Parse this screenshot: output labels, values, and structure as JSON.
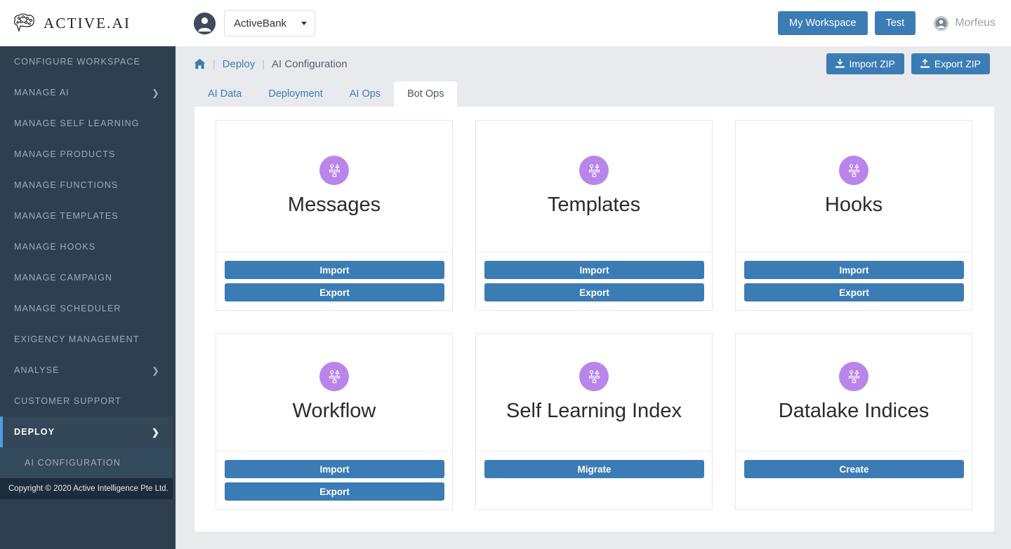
{
  "header": {
    "brand_name": "ACTIVE.AI",
    "brand_logo_icon": "brain-circuit-icon",
    "workspace_avatar_icon": "user-avatar-icon",
    "workspace_value": "ActiveBank",
    "workspace_caret_icon": "caret-down-icon",
    "my_workspace_label": "My Workspace",
    "test_label": "Test",
    "user_avatar_icon": "user-circle-icon",
    "user_name": "Morfeus"
  },
  "sidebar": {
    "items": [
      {
        "label": "CONFIGURE WORKSPACE",
        "has_chevron": false,
        "active": false
      },
      {
        "label": "MANAGE AI",
        "has_chevron": true,
        "active": false
      },
      {
        "label": "MANAGE SELF LEARNING",
        "has_chevron": false,
        "active": false
      },
      {
        "label": "MANAGE PRODUCTS",
        "has_chevron": false,
        "active": false
      },
      {
        "label": "MANAGE FUNCTIONS",
        "has_chevron": false,
        "active": false
      },
      {
        "label": "MANAGE TEMPLATES",
        "has_chevron": false,
        "active": false
      },
      {
        "label": "MANAGE HOOKS",
        "has_chevron": false,
        "active": false
      },
      {
        "label": "MANAGE CAMPAIGN",
        "has_chevron": false,
        "active": false
      },
      {
        "label": "MANAGE SCHEDULER",
        "has_chevron": false,
        "active": false
      },
      {
        "label": "EXIGENCY MANAGEMENT",
        "has_chevron": false,
        "active": false
      },
      {
        "label": "ANALYSE",
        "has_chevron": true,
        "active": false
      },
      {
        "label": "CUSTOMER SUPPORT",
        "has_chevron": false,
        "active": false
      },
      {
        "label": "DEPLOY",
        "has_chevron": true,
        "active": true
      }
    ],
    "sub_item": "AI CONFIGURATION",
    "chevron_icon": "chevron-right-icon",
    "copyright": "Copyright © 2020 Active Intelligence Pte Ltd.",
    "accent_color": "#4a9fe0",
    "background_color": "#2e3f50"
  },
  "topbar": {
    "home_icon": "home-icon",
    "breadcrumb": [
      {
        "label": "Deploy",
        "type": "link"
      },
      {
        "label": "AI Configuration",
        "type": "current"
      }
    ],
    "separator": "|",
    "import_zip_label": "Import ZIP",
    "import_zip_icon": "download-icon",
    "export_zip_label": "Export ZIP",
    "export_zip_icon": "upload-icon"
  },
  "tabs": [
    {
      "label": "AI Data",
      "active": false
    },
    {
      "label": "Deployment",
      "active": false
    },
    {
      "label": "AI Ops",
      "active": false
    },
    {
      "label": "Bot Ops",
      "active": true
    }
  ],
  "cards": [
    {
      "title": "Messages",
      "icon": "sitemap-icon",
      "icon_color": "#b985ea",
      "buttons": [
        "Import",
        "Export"
      ]
    },
    {
      "title": "Templates",
      "icon": "sitemap-icon",
      "icon_color": "#b985ea",
      "buttons": [
        "Import",
        "Export"
      ]
    },
    {
      "title": "Hooks",
      "icon": "sitemap-icon",
      "icon_color": "#b985ea",
      "buttons": [
        "Import",
        "Export"
      ]
    },
    {
      "title": "Workflow",
      "icon": "sitemap-icon",
      "icon_color": "#b985ea",
      "buttons": [
        "Import",
        "Export"
      ]
    },
    {
      "title": "Self Learning Index",
      "icon": "sitemap-icon",
      "icon_color": "#b985ea",
      "buttons": [
        "Migrate"
      ]
    },
    {
      "title": "Datalake Indices",
      "icon": "sitemap-icon",
      "icon_color": "#b985ea",
      "buttons": [
        "Create"
      ]
    }
  ],
  "theme": {
    "primary_button": "#3c7cb5",
    "page_background": "#e9eaee",
    "panel_background": "#ffffff",
    "link_color": "#3c7cb5"
  }
}
